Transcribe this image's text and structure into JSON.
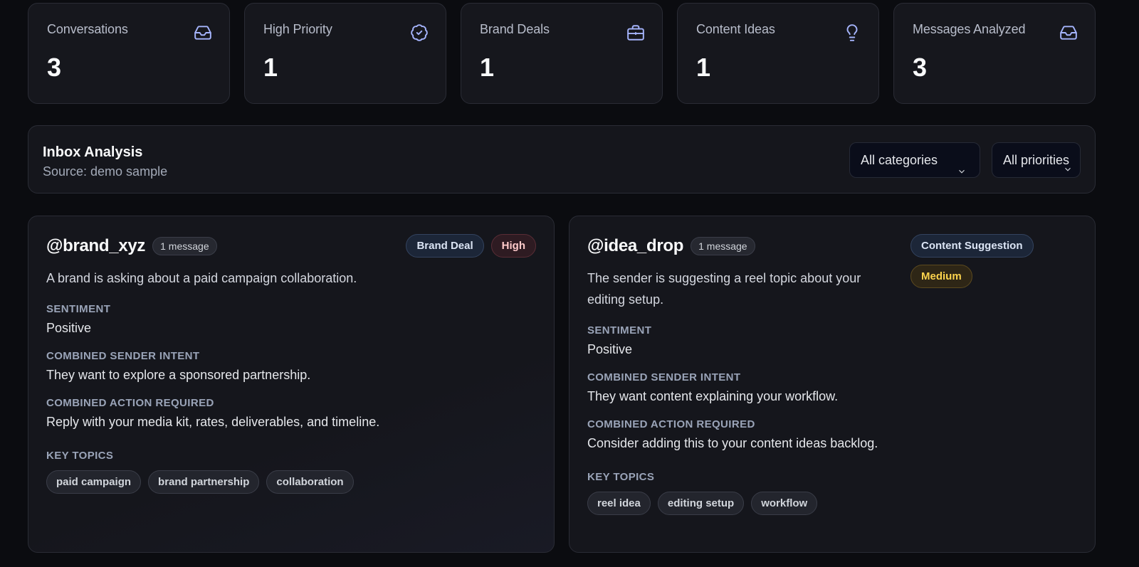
{
  "stats": [
    {
      "label": "Conversations",
      "value": "3",
      "icon": "inbox-icon"
    },
    {
      "label": "High Priority",
      "value": "1",
      "icon": "badge-check-icon"
    },
    {
      "label": "Brand Deals",
      "value": "1",
      "icon": "briefcase-icon"
    },
    {
      "label": "Content Ideas",
      "value": "1",
      "icon": "lightbulb-icon"
    },
    {
      "label": "Messages Analyzed",
      "value": "3",
      "icon": "inbox-icon"
    }
  ],
  "inbox": {
    "title": "Inbox Analysis",
    "source": "Source: demo sample",
    "category_select": "All categories",
    "priority_select": "All priorities"
  },
  "labels": {
    "sentiment": "SENTIMENT",
    "intent": "COMBINED SENDER INTENT",
    "action": "COMBINED ACTION REQUIRED",
    "topics": "KEY TOPICS"
  },
  "conversations": [
    {
      "handle": "@brand_xyz",
      "message_count": "1 message",
      "category": "Brand Deal",
      "priority": "High",
      "summary": "A brand is asking about a paid campaign collaboration.",
      "sentiment": "Positive",
      "intent": "They want to explore a sponsored partnership.",
      "action": "Reply with your media kit, rates, deliverables, and timeline.",
      "topics": [
        "paid campaign",
        "brand partnership",
        "collaboration"
      ]
    },
    {
      "handle": "@idea_drop",
      "message_count": "1 message",
      "category": "Content Suggestion",
      "priority": "Medium",
      "summary": "The sender is suggesting a reel topic about your editing setup.",
      "sentiment": "Positive",
      "intent": "They want content explaining your workflow.",
      "action": "Consider adding this to your content ideas backlog.",
      "topics": [
        "reel idea",
        "editing setup",
        "workflow"
      ]
    }
  ],
  "colors": {
    "background": "#0b0c10",
    "card": "#16171d",
    "accent_icon": "#a5b4fc",
    "high": "#fecaca",
    "medium": "#fcd34d"
  }
}
